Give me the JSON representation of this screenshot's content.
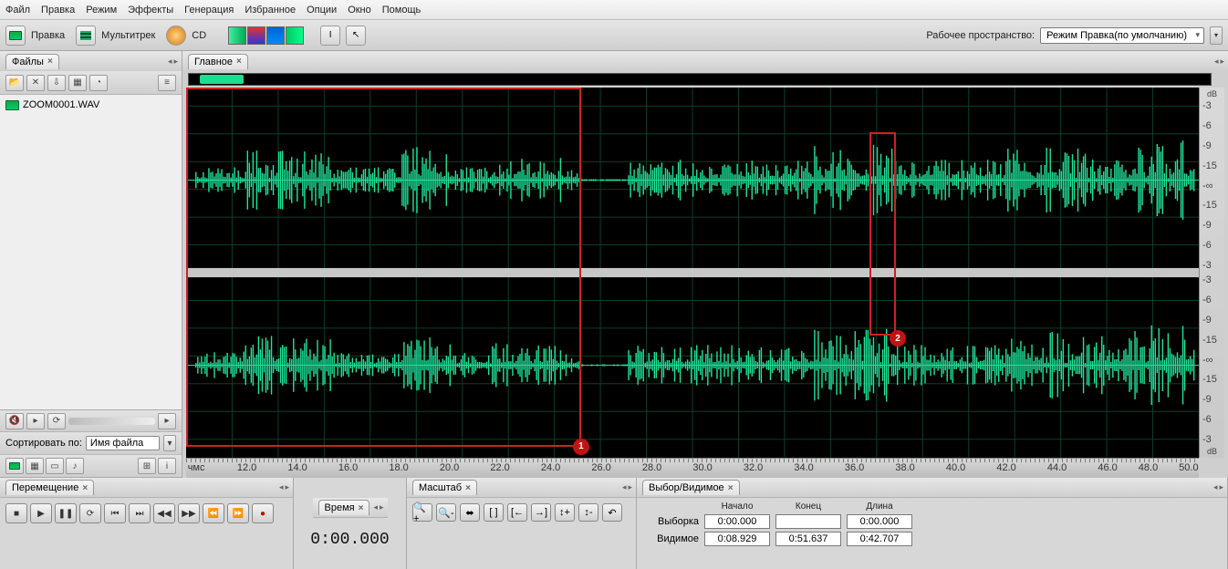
{
  "menu": [
    "Файл",
    "Правка",
    "Режим",
    "Эффекты",
    "Генерация",
    "Избранное",
    "Опции",
    "Окно",
    "Помощь"
  ],
  "toolbar": {
    "mode_edit": "Правка",
    "mode_multitrack": "Мультитрек",
    "mode_cd": "CD",
    "workspace_label": "Рабочее пространство:",
    "workspace_value": "Режим Правка(по умолчанию)"
  },
  "files_panel": {
    "tab": "Файлы",
    "items": [
      "ZOOM0001.WAV"
    ],
    "sort_label": "Сортировать по:",
    "sort_value": "Имя файла"
  },
  "main_tab": "Главное",
  "db_scale": {
    "unit": "dB",
    "ticks": [
      "-3",
      "-6",
      "-9",
      "-15",
      "-∞",
      "-15",
      "-9",
      "-6",
      "-3"
    ]
  },
  "time_ruler": {
    "unit": "чмс",
    "ticks": [
      "12.0",
      "14.0",
      "16.0",
      "18.0",
      "20.0",
      "22.0",
      "24.0",
      "26.0",
      "28.0",
      "30.0",
      "32.0",
      "34.0",
      "36.0",
      "38.0",
      "40.0",
      "42.0",
      "44.0",
      "46.0",
      "48.0",
      "50.0"
    ]
  },
  "annotations": {
    "box1_label": "1",
    "box2_label": "2"
  },
  "panels": {
    "transport": "Перемещение",
    "time": "Время",
    "zoom": "Масштаб",
    "selvis": "Выбор/Видимое"
  },
  "time_display": "0:00.000",
  "selvis": {
    "col_start": "Начало",
    "col_end": "Конец",
    "col_len": "Длина",
    "row_sel": "Выборка",
    "row_vis": "Видимое",
    "sel_start": "0:00.000",
    "sel_end": "",
    "sel_len": "0:00.000",
    "vis_start": "0:08.929",
    "vis_end": "0:51.637",
    "vis_len": "0:42.707"
  }
}
